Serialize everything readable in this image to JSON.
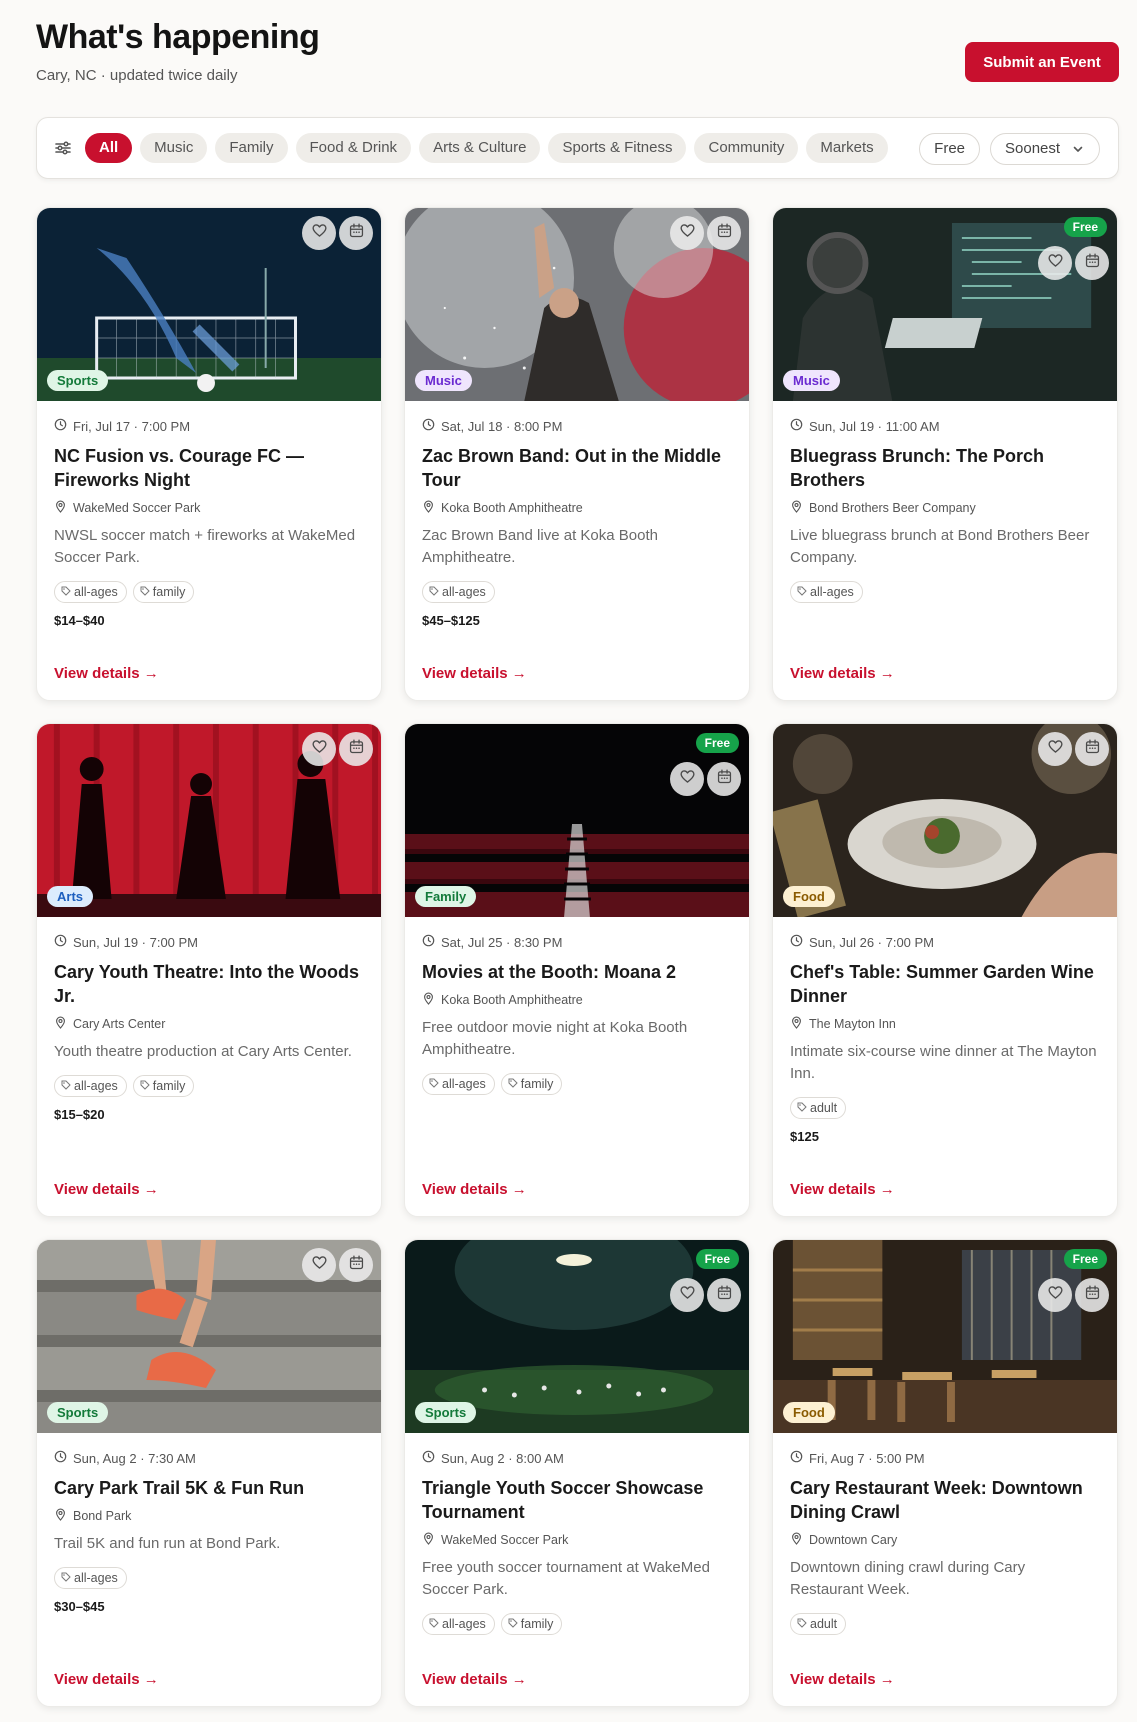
{
  "header": {
    "title": "What's happening",
    "subtitle": "Cary, NC · updated twice daily",
    "submit_label": "Submit an Event"
  },
  "filters": {
    "categories": [
      "All",
      "Music",
      "Family",
      "Food & Drink",
      "Arts & Culture",
      "Sports & Fitness",
      "Community",
      "Markets"
    ],
    "active": "All",
    "free_label": "Free",
    "sort_label": "Soonest"
  },
  "view_label": "View details →",
  "free_badge_label": "Free",
  "colors": {
    "accent": "#c8102e",
    "free": "#16a34a"
  },
  "events": [
    {
      "category": "Sports",
      "free": false,
      "date": "Fri, Jul 17 · 7:00 PM",
      "title": "NC Fusion vs. Courage FC — Fireworks Night",
      "venue": "WakeMed Soccer Park",
      "description": "NWSL soccer match + fireworks at WakeMed Soccer Park.",
      "tags": [
        "all-ages",
        "family"
      ],
      "price": "$14–$40",
      "image": "soccer-goal-night"
    },
    {
      "category": "Music",
      "free": false,
      "date": "Sat, Jul 18 · 8:00 PM",
      "title": "Zac Brown Band: Out in the Middle Tour",
      "venue": "Koka Booth Amphitheatre",
      "description": "Zac Brown Band live at Koka Booth Amphitheatre.",
      "tags": [
        "all-ages"
      ],
      "price": "$45–$125",
      "image": "concert-performer-smoke"
    },
    {
      "category": "Music",
      "free": true,
      "date": "Sun, Jul 19 · 11:00 AM",
      "title": "Bluegrass Brunch: The Porch Brothers",
      "venue": "Bond Brothers Beer Company",
      "description": "Live bluegrass brunch at Bond Brothers Beer Company.",
      "tags": [
        "all-ages"
      ],
      "price": "",
      "image": "person-at-computer"
    },
    {
      "category": "Arts",
      "free": false,
      "date": "Sun, Jul 19 · 7:00 PM",
      "title": "Cary Youth Theatre: Into the Woods Jr.",
      "venue": "Cary Arts Center",
      "description": "Youth theatre production at Cary Arts Center.",
      "tags": [
        "all-ages",
        "family"
      ],
      "price": "$15–$20",
      "image": "red-curtain-silhouettes"
    },
    {
      "category": "Family",
      "free": true,
      "date": "Sat, Jul 25 · 8:30 PM",
      "title": "Movies at the Booth: Moana 2",
      "venue": "Koka Booth Amphitheatre",
      "description": "Free outdoor movie night at Koka Booth Amphitheatre.",
      "tags": [
        "all-ages",
        "family"
      ],
      "price": "",
      "image": "theater-seats"
    },
    {
      "category": "Food",
      "free": false,
      "date": "Sun, Jul 26 · 7:00 PM",
      "title": "Chef's Table: Summer Garden Wine Dinner",
      "venue": "The Mayton Inn",
      "description": "Intimate six-course wine dinner at The Mayton Inn.",
      "tags": [
        "adult"
      ],
      "price": "$125",
      "image": "plated-dinner"
    },
    {
      "category": "Sports",
      "free": false,
      "date": "Sun, Aug 2 · 7:30 AM",
      "title": "Cary Park Trail 5K & Fun Run",
      "venue": "Bond Park",
      "description": "Trail 5K and fun run at Bond Park.",
      "tags": [
        "all-ages"
      ],
      "price": "$30–$45",
      "image": "runner-steps"
    },
    {
      "category": "Sports",
      "free": true,
      "date": "Sun, Aug 2 · 8:00 AM",
      "title": "Triangle Youth Soccer Showcase Tournament",
      "venue": "WakeMed Soccer Park",
      "description": "Free youth soccer tournament at WakeMed Soccer Park.",
      "tags": [
        "all-ages",
        "family"
      ],
      "price": "",
      "image": "floodlit-field"
    },
    {
      "category": "Food",
      "free": true,
      "date": "Fri, Aug 7 · 5:00 PM",
      "title": "Cary Restaurant Week: Downtown Dining Crawl",
      "venue": "Downtown Cary",
      "description": "Downtown dining crawl during Cary Restaurant Week.",
      "tags": [
        "adult"
      ],
      "price": "",
      "image": "restaurant-interior"
    }
  ]
}
